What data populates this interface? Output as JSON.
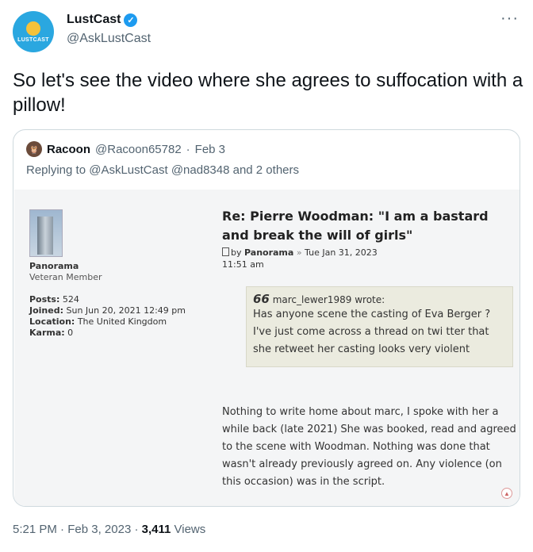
{
  "author": {
    "avatar_text": "LUSTCAST",
    "display_name": "LustCast",
    "handle": "@AskLustCast",
    "verified": true
  },
  "more_icon": "···",
  "tweet_text": "So let's see the video where she agrees to suffocation with a pillow!",
  "quote": {
    "avatar_icon": "🦉",
    "display_name": "Racoon",
    "handle": "@Racoon65782",
    "separator": "·",
    "date": "Feb 3",
    "reply_prefix": "Replying to ",
    "reply_to": "@AskLustCast @nad8348",
    "reply_suffix": " and 2 others",
    "forum": {
      "username": "Panorama",
      "rank": "Veteran Member",
      "stats": [
        {
          "label": "Posts:",
          "value": "524"
        },
        {
          "label": "Joined:",
          "value": "Sun Jun 20, 2021 12:49 pm"
        },
        {
          "label": "Location:",
          "value": "The United Kingdom"
        },
        {
          "label": "Karma:",
          "value": "0"
        }
      ],
      "title": "Re: Pierre Woodman: \"I am a bastard and break the will of girls\"",
      "meta_by": "by ",
      "meta_author": "Panorama",
      "meta_arrow": "»",
      "meta_date": "Tue Jan 31, 2023 11:51 am",
      "quoted_author": "marc_lewer1989 wrote:",
      "quoted_text": "Has anyone scene the casting of Eva Berger ? I've just come across a thread on twi tter that she retweet her casting looks very violent",
      "body": "Nothing to write home about marc, I spoke with her a while back (late 2021) She was booked, read and agreed to the scene with Woodman. Nothing was done that wasn't already previously agreed on. Any violence (on this occasion) was in the script."
    }
  },
  "footer": {
    "time": "5:21 PM",
    "sep1": " · ",
    "date": "Feb 3, 2023",
    "sep2": " · ",
    "views_count": "3,411",
    "views_label": " Views"
  },
  "colors": {
    "link": "#1d9bf0",
    "muted": "#536471",
    "verified": "#1d9bf0",
    "forum_bg": "#f4f5f6",
    "quote_bg": "#ebebdf"
  }
}
